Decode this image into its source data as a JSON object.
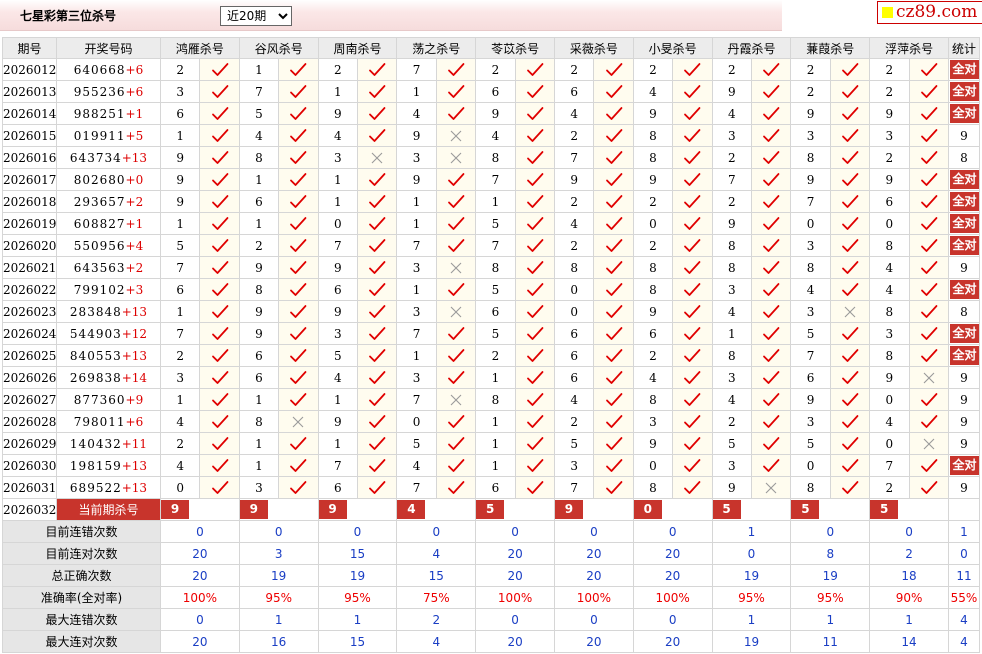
{
  "header": {
    "title": "七星彩第三位杀号",
    "period_select": {
      "selected": "近20期",
      "options": [
        "近20期"
      ]
    },
    "logo": "cz89.com"
  },
  "columns": {
    "period": "期号",
    "number": "开奖号码",
    "experts": [
      "鸿雁杀号",
      "谷风杀号",
      "周南杀号",
      "荡之杀号",
      "苓苡杀号",
      "采薇杀号",
      "小旻杀号",
      "丹霞杀号",
      "蒹葭杀号",
      "浮萍杀号"
    ],
    "stat": "统计"
  },
  "rows": [
    {
      "p": "2026012",
      "n": "640668",
      "s": "+6",
      "k": [
        "2",
        "1",
        "2",
        "7",
        "2",
        "2",
        "2",
        "2",
        "2",
        "2"
      ],
      "r": [
        1,
        1,
        1,
        1,
        1,
        1,
        1,
        1,
        1,
        1
      ],
      "st": "全对"
    },
    {
      "p": "2026013",
      "n": "955236",
      "s": "+6",
      "k": [
        "3",
        "7",
        "1",
        "1",
        "6",
        "6",
        "4",
        "9",
        "2",
        "2"
      ],
      "r": [
        1,
        1,
        1,
        1,
        1,
        1,
        1,
        1,
        1,
        1
      ],
      "st": "全对"
    },
    {
      "p": "2026014",
      "n": "988251",
      "s": "+1",
      "k": [
        "6",
        "5",
        "9",
        "4",
        "9",
        "4",
        "9",
        "4",
        "9",
        "9"
      ],
      "r": [
        1,
        1,
        1,
        1,
        1,
        1,
        1,
        1,
        1,
        1
      ],
      "st": "全对"
    },
    {
      "p": "2026015",
      "n": "019911",
      "s": "+5",
      "k": [
        "1",
        "4",
        "4",
        "9",
        "4",
        "2",
        "8",
        "3",
        "3",
        "3"
      ],
      "r": [
        1,
        1,
        1,
        0,
        1,
        1,
        1,
        1,
        1,
        1
      ],
      "st": "9"
    },
    {
      "p": "2026016",
      "n": "643734",
      "s": "+13",
      "k": [
        "9",
        "8",
        "3",
        "3",
        "8",
        "7",
        "8",
        "2",
        "8",
        "2"
      ],
      "r": [
        1,
        1,
        0,
        0,
        1,
        1,
        1,
        1,
        1,
        1
      ],
      "st": "8"
    },
    {
      "p": "2026017",
      "n": "802680",
      "s": "+0",
      "k": [
        "9",
        "1",
        "1",
        "9",
        "7",
        "9",
        "9",
        "7",
        "9",
        "9"
      ],
      "r": [
        1,
        1,
        1,
        1,
        1,
        1,
        1,
        1,
        1,
        1
      ],
      "st": "全对"
    },
    {
      "p": "2026018",
      "n": "293657",
      "s": "+2",
      "k": [
        "9",
        "6",
        "1",
        "1",
        "1",
        "2",
        "2",
        "2",
        "7",
        "6"
      ],
      "r": [
        1,
        1,
        1,
        1,
        1,
        1,
        1,
        1,
        1,
        1
      ],
      "st": "全对"
    },
    {
      "p": "2026019",
      "n": "608827",
      "s": "+1",
      "k": [
        "1",
        "1",
        "0",
        "1",
        "5",
        "4",
        "0",
        "9",
        "0",
        "0"
      ],
      "r": [
        1,
        1,
        1,
        1,
        1,
        1,
        1,
        1,
        1,
        1
      ],
      "st": "全对"
    },
    {
      "p": "2026020",
      "n": "550956",
      "s": "+4",
      "k": [
        "5",
        "2",
        "7",
        "7",
        "7",
        "2",
        "2",
        "8",
        "3",
        "8"
      ],
      "r": [
        1,
        1,
        1,
        1,
        1,
        1,
        1,
        1,
        1,
        1
      ],
      "st": "全对"
    },
    {
      "p": "2026021",
      "n": "643563",
      "s": "+2",
      "k": [
        "7",
        "9",
        "9",
        "3",
        "8",
        "8",
        "8",
        "8",
        "8",
        "4"
      ],
      "r": [
        1,
        1,
        1,
        0,
        1,
        1,
        1,
        1,
        1,
        1
      ],
      "st": "9"
    },
    {
      "p": "2026022",
      "n": "799102",
      "s": "+3",
      "k": [
        "6",
        "8",
        "6",
        "1",
        "5",
        "0",
        "8",
        "3",
        "4",
        "4"
      ],
      "r": [
        1,
        1,
        1,
        1,
        1,
        1,
        1,
        1,
        1,
        1
      ],
      "st": "全对"
    },
    {
      "p": "2026023",
      "n": "283848",
      "s": "+13",
      "k": [
        "1",
        "9",
        "9",
        "3",
        "6",
        "0",
        "9",
        "4",
        "3",
        "8"
      ],
      "r": [
        1,
        1,
        1,
        0,
        1,
        1,
        1,
        1,
        0,
        1
      ],
      "st": "8"
    },
    {
      "p": "2026024",
      "n": "544903",
      "s": "+12",
      "k": [
        "7",
        "9",
        "3",
        "7",
        "5",
        "6",
        "6",
        "1",
        "5",
        "3"
      ],
      "r": [
        1,
        1,
        1,
        1,
        1,
        1,
        1,
        1,
        1,
        1
      ],
      "st": "全对"
    },
    {
      "p": "2026025",
      "n": "840553",
      "s": "+13",
      "k": [
        "2",
        "6",
        "5",
        "1",
        "2",
        "6",
        "2",
        "8",
        "7",
        "8"
      ],
      "r": [
        1,
        1,
        1,
        1,
        1,
        1,
        1,
        1,
        1,
        1
      ],
      "st": "全对"
    },
    {
      "p": "2026026",
      "n": "269838",
      "s": "+14",
      "k": [
        "3",
        "6",
        "4",
        "3",
        "1",
        "6",
        "4",
        "3",
        "6",
        "9"
      ],
      "r": [
        1,
        1,
        1,
        1,
        1,
        1,
        1,
        1,
        1,
        0
      ],
      "st": "9"
    },
    {
      "p": "2026027",
      "n": "877360",
      "s": "+9",
      "k": [
        "1",
        "1",
        "1",
        "7",
        "8",
        "4",
        "8",
        "4",
        "9",
        "0"
      ],
      "r": [
        1,
        1,
        1,
        0,
        1,
        1,
        1,
        1,
        1,
        1
      ],
      "st": "9"
    },
    {
      "p": "2026028",
      "n": "798011",
      "s": "+6",
      "k": [
        "4",
        "8",
        "9",
        "0",
        "1",
        "2",
        "3",
        "2",
        "3",
        "4"
      ],
      "r": [
        1,
        0,
        1,
        1,
        1,
        1,
        1,
        1,
        1,
        1
      ],
      "st": "9"
    },
    {
      "p": "2026029",
      "n": "140432",
      "s": "+11",
      "k": [
        "2",
        "1",
        "1",
        "5",
        "1",
        "5",
        "9",
        "5",
        "5",
        "0"
      ],
      "r": [
        1,
        1,
        1,
        1,
        1,
        1,
        1,
        1,
        1,
        0
      ],
      "st": "9"
    },
    {
      "p": "2026030",
      "n": "198159",
      "s": "+13",
      "k": [
        "4",
        "1",
        "7",
        "4",
        "1",
        "3",
        "0",
        "3",
        "0",
        "7"
      ],
      "r": [
        1,
        1,
        1,
        1,
        1,
        1,
        1,
        1,
        1,
        1
      ],
      "st": "全对"
    },
    {
      "p": "2026031",
      "n": "689522",
      "s": "+13",
      "k": [
        "0",
        "3",
        "6",
        "7",
        "6",
        "7",
        "8",
        "9",
        "8",
        "2"
      ],
      "r": [
        1,
        1,
        1,
        1,
        1,
        1,
        1,
        0,
        1,
        1
      ],
      "st": "9"
    }
  ],
  "current": {
    "p": "2026032",
    "label": "当前期杀号",
    "k": [
      "9",
      "9",
      "9",
      "4",
      "5",
      "9",
      "0",
      "5",
      "5",
      "5"
    ]
  },
  "stats": [
    {
      "label": "目前连错次数",
      "v": [
        "0",
        "0",
        "0",
        "0",
        "0",
        "0",
        "0",
        "1",
        "0",
        "0"
      ],
      "t": "1",
      "red": false
    },
    {
      "label": "目前连对次数",
      "v": [
        "20",
        "3",
        "15",
        "4",
        "20",
        "20",
        "20",
        "0",
        "8",
        "2"
      ],
      "t": "0",
      "red": false
    },
    {
      "label": "总正确次数",
      "v": [
        "20",
        "19",
        "19",
        "15",
        "20",
        "20",
        "20",
        "19",
        "19",
        "18"
      ],
      "t": "11",
      "red": false
    },
    {
      "label": "准确率(全对率)",
      "v": [
        "100%",
        "95%",
        "95%",
        "75%",
        "100%",
        "100%",
        "100%",
        "95%",
        "95%",
        "90%"
      ],
      "t": "55%",
      "red": true
    },
    {
      "label": "最大连错次数",
      "v": [
        "0",
        "1",
        "1",
        "2",
        "0",
        "0",
        "0",
        "1",
        "1",
        "1"
      ],
      "t": "4",
      "red": false
    },
    {
      "label": "最大连对次数",
      "v": [
        "20",
        "16",
        "15",
        "4",
        "20",
        "20",
        "20",
        "19",
        "11",
        "14"
      ],
      "t": "4",
      "red": false
    }
  ],
  "colors": {
    "check": "#e00000",
    "cross": "#9a9a9a",
    "badge": "#c8342c",
    "stat_value": "#1a3ec4",
    "stat_rate": "#e00000"
  }
}
